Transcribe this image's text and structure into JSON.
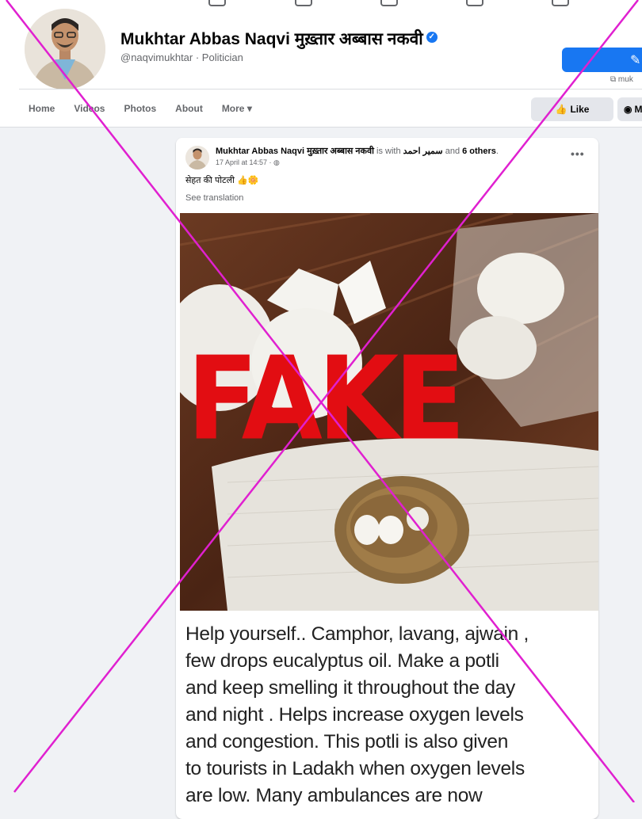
{
  "profile": {
    "name": "Mukhtar Abbas Naqvi मुख़्तार अब्बास नकवी",
    "handle": "@naqvimukhtar · Politician",
    "verified_mark": "✓",
    "external_link_label": "muk"
  },
  "nav": {
    "tabs": [
      {
        "label": "Home"
      },
      {
        "label": "Videos"
      },
      {
        "label": "Photos"
      },
      {
        "label": "About"
      },
      {
        "label": "More ▾"
      }
    ]
  },
  "actions": {
    "like_label": "Like",
    "message_label": "M"
  },
  "post": {
    "author": "Mukhtar Abbas Naqvi मुख़्तार अब्बास नकवी",
    "with_text": "is with",
    "tagged_name": "سمير احمد",
    "and_text": "and",
    "others": "6 others",
    "period": ".",
    "date": "17 April at 14:57 · ",
    "privacy_icon": "globe-icon",
    "menu_label": "•••",
    "caption": "सेहत की पोटली 👍🌼",
    "see_translation": "See translation",
    "body_lines": [
      "Help yourself.. Camphor, lavang, ajwain ,",
      "few drops eucalyptus oil. Make a potli",
      "and keep smelling it throughout the day",
      "and night . Helps increase oxygen levels",
      "and congestion. This potli is also given",
      "to tourists in Ladakh when oxygen levels",
      "are low. Many ambulances are now"
    ]
  },
  "overlay": {
    "stamp": "FAKE",
    "stamp_color": "#e20d12",
    "cross_color": "#e020d0"
  },
  "colors": {
    "accent": "#1877f2",
    "background": "#f0f2f5"
  }
}
